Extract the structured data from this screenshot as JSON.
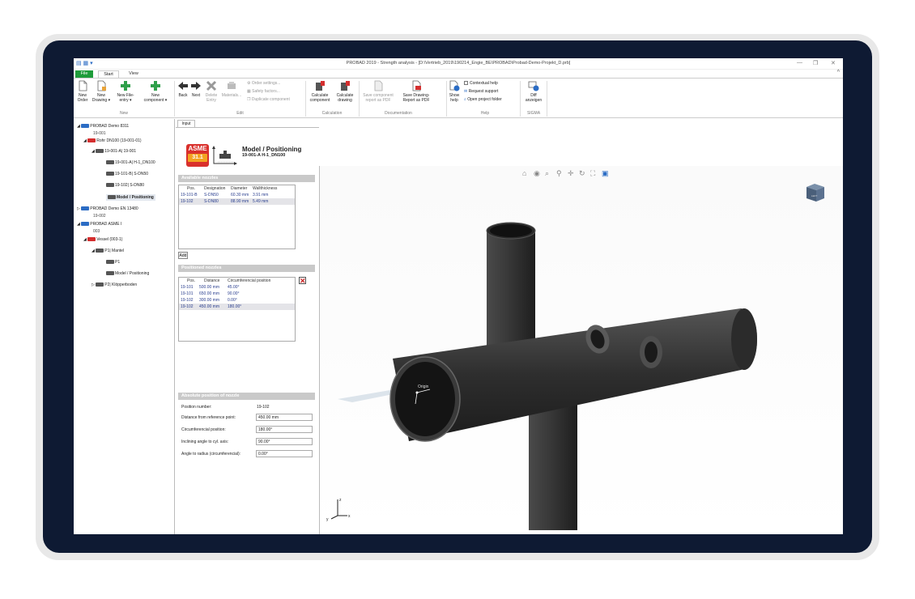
{
  "window": {
    "title": "PROBAD 2019 - Strength analysis - [D:\\Vertrieb_2019\\190214_Engie_BE\\PROBAD\\Probad-Demo-Projekt_D.prb]",
    "min": "—",
    "max": "❐",
    "close": "✕",
    "qat": "▤ ▦ ▾"
  },
  "tabs": {
    "file": "File",
    "start": "Start",
    "view": "View"
  },
  "ribbon": {
    "new_group": {
      "label": "New",
      "new_order": "New Order",
      "new_drawing": "New Drawing ▾",
      "new_file_entry": "New File-entry ▾",
      "new_component": "New component ▾"
    },
    "edit_group": {
      "label": "Edit",
      "back": "Back",
      "next": "Next",
      "delete_entry": "Delete Entry",
      "materials": "Materials...",
      "order_settings": "Order settings...",
      "safety_factors": "Safety factors...",
      "duplicate_component": "Duplicate component"
    },
    "calc_group": {
      "label": "Calculation",
      "calc_component": "Calculate component",
      "calc_drawing": "Calculate drawing"
    },
    "doc_group": {
      "label": "Documentation",
      "save_component_report": "Save component report as PDF",
      "save_drawing_report": "Save Drawing-Report as PDF"
    },
    "help_group": {
      "label": "Help",
      "show_help": "Show help",
      "contextual_help": "Contextual help",
      "request_support": "Request support",
      "open_project_folder": "Open project folder"
    },
    "sigma_group": {
      "label": "SIGMA",
      "diff": "Diff anzeigen"
    }
  },
  "tree": {
    "n1": "PROBAD Demo 8311",
    "n1_sub": "19-001",
    "n2": "Rohr DN100 (19-001-01)",
    "n3": "19-001-A| 19-001",
    "n4": "19-001-A| H-1_DN100",
    "n5": "19-101-B| S-DN50",
    "n6": "19-102| S-DN80",
    "n7": "Model / Positioning",
    "n8": "PROBAD Demo EN 13480",
    "n8_sub": "19-002",
    "n9": "PROBAD ASME I",
    "n9_sub": "003",
    "n10": "Vessel (003-1)",
    "n11": "P1| Mantel",
    "n12": "P1",
    "n13": "Model / Positioning",
    "n14": "P2| Klöpperboden"
  },
  "panel": {
    "tab": "Input",
    "logo_top": "ASME",
    "logo_bottom": "31.1",
    "title": "Model / Positioning",
    "subtitle": "19-001-A H-1_DN100",
    "available_header": "Available nozzles",
    "available_cols": {
      "pos": "Pos.",
      "designation": "Designation",
      "diameter": "Diameter",
      "wall": "Wallthickness"
    },
    "available_rows": [
      {
        "pos": "19-101-B",
        "designation": "S-DN50",
        "diameter": "60.30 mm",
        "wall": "3.91 mm"
      },
      {
        "pos": "19-102",
        "designation": "S-DN80",
        "diameter": "88.90 mm",
        "wall": "5.49 mm"
      }
    ],
    "add_button": "Add",
    "positioned_header": "Positioned nozzles",
    "positioned_cols": {
      "pos": "Pos.",
      "distance": "Distance",
      "circ": "Circumferencial position"
    },
    "positioned_rows": [
      {
        "pos": "19-101",
        "distance": "500.00 mm",
        "circ": "45.00°"
      },
      {
        "pos": "19-101",
        "distance": "650.00 mm",
        "circ": "90.00°"
      },
      {
        "pos": "19-102",
        "distance": "300.00 mm",
        "circ": "0.00°"
      },
      {
        "pos": "19-102",
        "distance": "450.00 mm",
        "circ": "180.00°"
      }
    ],
    "delete_button": "✕",
    "absolute_header": "Absolute position of nozzle",
    "fields": {
      "position_number_label": "Position number:",
      "position_number_value": "19-102",
      "distance_label": "Distance from reference point:",
      "distance_value": "450.00 mm",
      "circ_label": "Circumferencial position:",
      "circ_value": "180.00°",
      "incline_label": "Inclining angle to cyl. axis:",
      "incline_value": "90.00°",
      "radius_label": "Angle to radius (circumferencial):",
      "radius_value": "0.00°"
    }
  },
  "viewport": {
    "tools": [
      "⌂",
      "◉",
      "⌕",
      "⚲",
      "✛",
      "↻",
      "⛶",
      "▣"
    ],
    "origin_label": "Origin",
    "axis_x": "x",
    "axis_y": "y",
    "axis_z": "z",
    "cube_label": "LEFT"
  },
  "colors": {
    "file_tab": "#1e9c3a",
    "asme_red": "#d9302c",
    "asme_orange": "#f3a321",
    "frame": "#0e1a33"
  }
}
